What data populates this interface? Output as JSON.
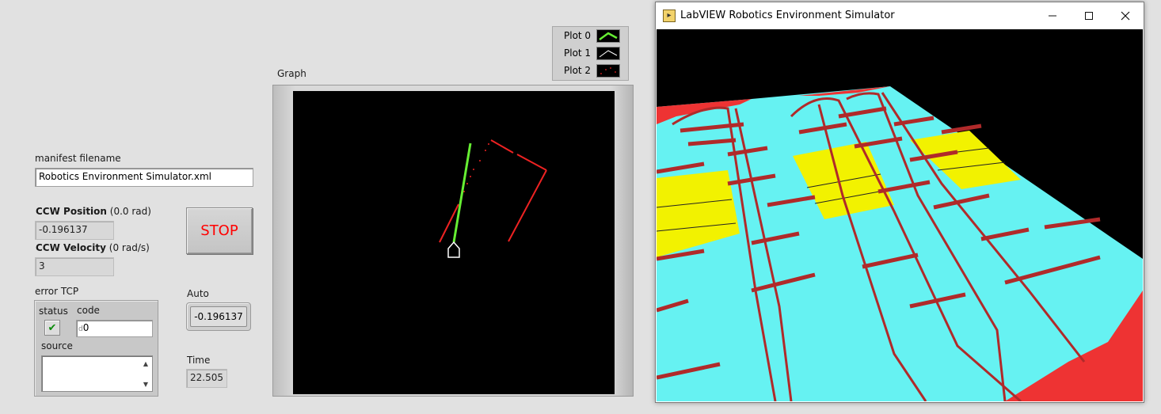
{
  "manifest": {
    "label": "manifest filename",
    "value": "Robotics Environment Simulator.xml"
  },
  "ccw_position": {
    "label_bold": "CCW Position",
    "label_unit": "(0.0 rad)",
    "value": "-0.196137"
  },
  "ccw_velocity": {
    "label_bold": "CCW Velocity",
    "label_unit": "(0 rad/s)",
    "value": "3"
  },
  "stop_button": {
    "label": "STOP",
    "color": "#ff0000"
  },
  "auto": {
    "label": "Auto",
    "value": "-0.196137"
  },
  "time": {
    "label": "Time",
    "value": "22.505"
  },
  "error_cluster": {
    "label": "error TCP",
    "status_label": "status",
    "status_icon": "checkmark-icon",
    "code_label": "code",
    "code_radix": "d",
    "code_value": "0",
    "source_label": "source",
    "source_value": ""
  },
  "graph": {
    "label": "Graph",
    "legend": [
      {
        "name": "Plot 0",
        "color": "#66ee33"
      },
      {
        "name": "Plot 1",
        "color": "#ffffff"
      },
      {
        "name": "Plot 2",
        "color": "#ee2222"
      }
    ]
  },
  "simulator": {
    "title": "LabVIEW Robotics Environment Simulator",
    "minimize_icon": "minimize-icon",
    "maximize_icon": "maximize-icon",
    "close_icon": "close-icon",
    "colors": {
      "floor": "#66f2f2",
      "wall": "#b02a2a",
      "stripe": "#f2f200",
      "edge": "#ee3333",
      "sky": "#000000"
    }
  }
}
